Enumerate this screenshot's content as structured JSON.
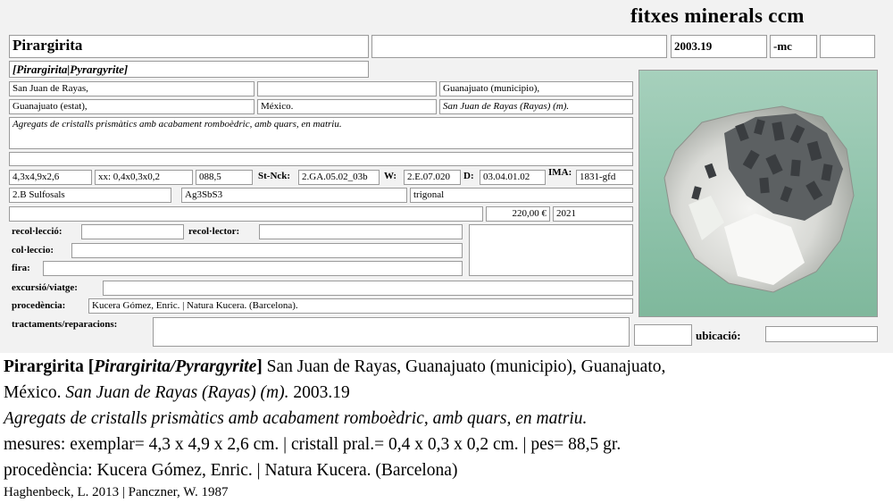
{
  "header": {
    "brand": "fitxes minerals ccm"
  },
  "card": {
    "name": "Pirargirita",
    "blank1": "",
    "code": "2003.19",
    "suffix": "-mc",
    "blank2": "",
    "synonyms": "[Pirargirita|Pyrargyrite]",
    "loc1": "San Juan de Rayas,",
    "loc2": "",
    "loc3": "Guanajuato (municipio),",
    "loc4": "Guanajuato (estat),",
    "loc5": "México.",
    "loc6": "San Juan de Rayas (Rayas) (m).",
    "description": "Agregats de cristalls prismàtics amb acabament romboèdric, amb quars, en matriu.",
    "description2": "",
    "dims": "4,3x4,9x2,6",
    "crystal": "xx: 0,4x0,3x0,2",
    "weight": "088,5",
    "stnck_label": "St-Nck:",
    "stnck": "2.GA.05.02_03b",
    "w_label": "W:",
    "w": "2.E.07.020",
    "d_label": "D:",
    "d": "03.04.01.02",
    "ima_label": "IMA:",
    "ima": "1831-gfd",
    "class": "2.B Sulfosals",
    "formula": "Ag3SbS3",
    "system": "trigonal",
    "row_blank": "",
    "price": "220,00 €",
    "year": "2021",
    "recol_label": "recol·lecció:",
    "recol": "",
    "recollector_label": "recol·lector:",
    "recollector": "",
    "collection_label": "col·leccio:",
    "collection": "",
    "fira_label": "fira:",
    "fira": "",
    "notes": "",
    "trip_label": "excursió/viatge:",
    "trip": "",
    "origin_label": "procedència:",
    "origin": "Kucera Gómez, Enric. | Natura Kucera. (Barcelona).",
    "treat_label": "tractaments/reparacions:",
    "treat": "",
    "small_blank": "",
    "location_label": "ubicació:",
    "location": ""
  },
  "caption": {
    "name": "Pirargirita",
    "syn_open": "[",
    "syn": "Pirargirita/Pyrargyrite",
    "syn_close": "]",
    "locality_a": "San Juan de Rayas, Guanajuato (municipio), Guanajuato,",
    "locality_b": "México.",
    "locality_italic": "San Juan de Rayas (Rayas) (m).",
    "code": "2003.19",
    "description": "Agregats de cristalls prismàtics amb acabament romboèdric, amb quars, en matriu.",
    "measures": "mesures: exemplar= 4,3 x 4,9 x 2,6 cm. | cristall pral.= 0,4 x 0,3 x 0,2 cm. | pes= 88,5 gr.",
    "origin": "procedència:  Kucera Gómez, Enric. | Natura Kucera. (Barcelona)",
    "refs": "Haghenbeck, L. 2013 | Panczner, W. 1987"
  }
}
